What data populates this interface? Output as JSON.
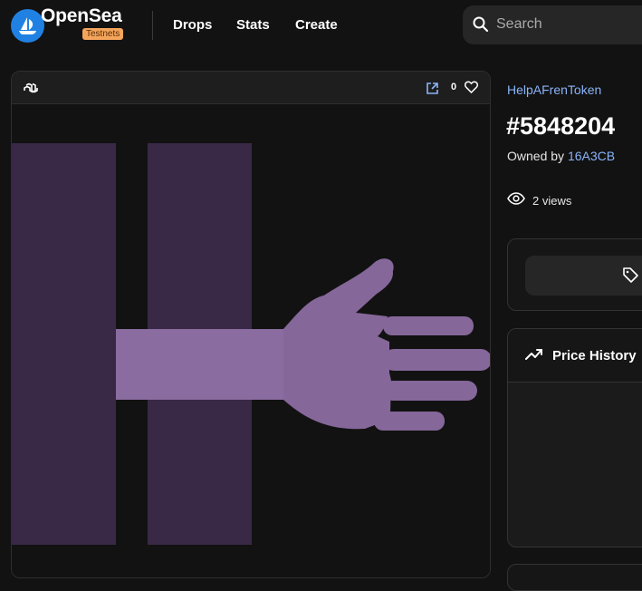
{
  "header": {
    "brand": "OpenSea",
    "badge": "Testnets",
    "nav": [
      {
        "label": "Drops"
      },
      {
        "label": "Stats"
      },
      {
        "label": "Create"
      }
    ],
    "search": {
      "placeholder": "Search",
      "value": ""
    }
  },
  "media": {
    "favorite_count": "0",
    "artwork_colors": {
      "background": "#121212",
      "bar_dark": "#3a2847",
      "hand": "#85679a",
      "hand_light": "#8a6ca0"
    }
  },
  "item": {
    "collection": "HelpAFrenToken",
    "title": "#5848204",
    "owned_prefix": "Owned by ",
    "owner": "16A3CB",
    "views": "2 views"
  },
  "price_history": {
    "title": "Price History"
  },
  "theme": {
    "accent": "#2081e2",
    "link": "#8ab4f8",
    "badge": "#f5a55b"
  }
}
